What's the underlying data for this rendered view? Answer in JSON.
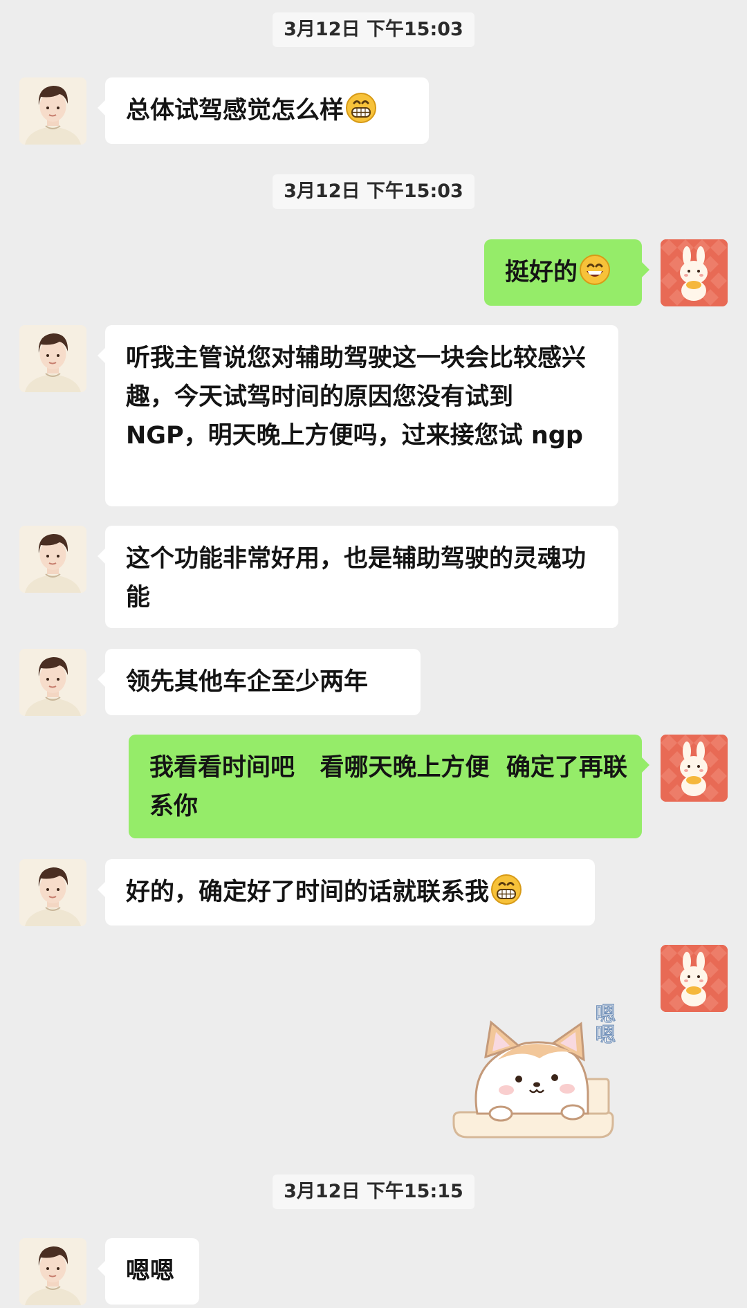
{
  "timestamps": [
    "3月12日  下午15:03",
    "3月12日  下午15:03",
    "3月12日  下午15:15"
  ],
  "messages": [
    {
      "text": "总体试驾感觉怎么样",
      "emoji": "grinning-face-icon"
    },
    {
      "text": "挺好的",
      "emoji": "smiling-face-icon"
    },
    {
      "text": "听我主管说您对辅助驾驶这一块会比较感兴趣，今天试驾时间的原因您没有试到 NGP，明天晚上方便吗，过来接您试 ngp"
    },
    {
      "text": "这个功能非常好用，也是辅助驾驶的灵魂功能"
    },
    {
      "text": "领先其他车企至少两年"
    },
    {
      "text": "我看看时间吧   看哪天晚上方便  确定了再联系你"
    },
    {
      "text": "好的，确定好了时间的话就联系我",
      "emoji": "grinning-face-icon"
    },
    {
      "text": "嗯嗯"
    }
  ],
  "sticker": {
    "text": "嗯嗯",
    "name": "shiba-dog-sticker"
  },
  "colors": {
    "background": "#ededed",
    "incoming_bubble": "#ffffff",
    "outgoing_bubble": "#95ec69"
  }
}
